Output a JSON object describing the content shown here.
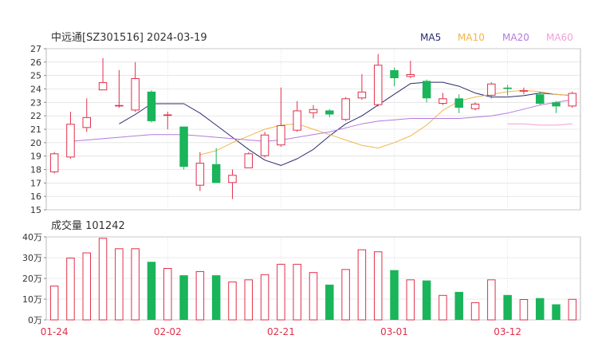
{
  "header": {
    "title": "中远通[SZ301516] 2024-03-19",
    "legend": [
      {
        "name": "MA5",
        "color": "#2a2a6e"
      },
      {
        "name": "MA10",
        "color": "#f2b64a"
      },
      {
        "name": "MA20",
        "color": "#b47adf"
      },
      {
        "name": "MA60",
        "color": "#f2a0d8"
      }
    ]
  },
  "volume_panel": {
    "label": "成交量 101242"
  },
  "colors": {
    "up": "#e0304a",
    "down": "#1ab45a",
    "grid": "#d8d8d8",
    "axis_text": "#333333",
    "date_text": "#e0304a"
  },
  "chart_data": [
    {
      "type": "candlestick",
      "title": "中远通[SZ301516] 2024-03-19",
      "ylim": [
        15,
        27
      ],
      "yticks": [
        15,
        16,
        17,
        18,
        19,
        20,
        21,
        22,
        23,
        24,
        25,
        26,
        27
      ],
      "xticks": [
        {
          "label": "01-24",
          "index": 0
        },
        {
          "label": "02-02",
          "index": 7
        },
        {
          "label": "02-21",
          "index": 14
        },
        {
          "label": "03-01",
          "index": 21
        },
        {
          "label": "03-12",
          "index": 28
        }
      ],
      "grid": true,
      "legend_position": "top-right",
      "candles": [
        {
          "open": 17.8,
          "close": 19.2,
          "high": 19.3,
          "low": 17.7
        },
        {
          "open": 18.9,
          "close": 21.4,
          "high": 22.3,
          "low": 18.8
        },
        {
          "open": 21.1,
          "close": 21.9,
          "high": 23.3,
          "low": 20.8
        },
        {
          "open": 23.9,
          "close": 24.5,
          "high": 26.3,
          "low": 23.9
        },
        {
          "open": 22.7,
          "close": 22.8,
          "high": 25.4,
          "low": 22.6
        },
        {
          "open": 22.4,
          "close": 24.8,
          "high": 26.0,
          "low": 22.3
        },
        {
          "open": 23.8,
          "close": 21.6,
          "high": 23.9,
          "low": 21.5
        },
        {
          "open": 22.0,
          "close": 22.1,
          "high": 22.3,
          "low": 21.0
        },
        {
          "open": 21.2,
          "close": 18.2,
          "high": 21.2,
          "low": 18.0
        },
        {
          "open": 16.8,
          "close": 18.5,
          "high": 19.3,
          "low": 16.4
        },
        {
          "open": 18.4,
          "close": 17.0,
          "high": 19.6,
          "low": 17.0
        },
        {
          "open": 17.0,
          "close": 17.6,
          "high": 18.0,
          "low": 15.8
        },
        {
          "open": 18.1,
          "close": 19.2,
          "high": 19.3,
          "low": 18.1
        },
        {
          "open": 19.0,
          "close": 20.6,
          "high": 20.8,
          "low": 18.9
        },
        {
          "open": 19.8,
          "close": 21.3,
          "high": 24.1,
          "low": 19.7
        },
        {
          "open": 20.9,
          "close": 22.4,
          "high": 23.1,
          "low": 20.8
        },
        {
          "open": 22.2,
          "close": 22.5,
          "high": 22.8,
          "low": 21.8
        },
        {
          "open": 22.4,
          "close": 22.1,
          "high": 22.5,
          "low": 21.9
        },
        {
          "open": 21.7,
          "close": 23.3,
          "high": 23.4,
          "low": 21.6
        },
        {
          "open": 23.3,
          "close": 23.8,
          "high": 25.1,
          "low": 23.2
        },
        {
          "open": 22.8,
          "close": 25.8,
          "high": 26.6,
          "low": 22.7
        },
        {
          "open": 25.4,
          "close": 24.8,
          "high": 25.6,
          "low": 24.2
        },
        {
          "open": 24.9,
          "close": 25.1,
          "high": 26.1,
          "low": 24.8
        },
        {
          "open": 24.6,
          "close": 23.3,
          "high": 24.7,
          "low": 23.0
        },
        {
          "open": 22.9,
          "close": 23.3,
          "high": 23.7,
          "low": 22.8
        },
        {
          "open": 23.3,
          "close": 22.6,
          "high": 23.6,
          "low": 22.2
        },
        {
          "open": 22.5,
          "close": 22.9,
          "high": 23.0,
          "low": 22.4
        },
        {
          "open": 23.5,
          "close": 24.4,
          "high": 24.5,
          "low": 23.3
        },
        {
          "open": 24.1,
          "close": 24.0,
          "high": 24.3,
          "low": 23.5
        },
        {
          "open": 23.8,
          "close": 23.9,
          "high": 24.1,
          "low": 23.6
        },
        {
          "open": 23.6,
          "close": 22.9,
          "high": 23.8,
          "low": 22.8
        },
        {
          "open": 23.0,
          "close": 22.7,
          "high": 23.1,
          "low": 22.2
        },
        {
          "open": 22.7,
          "close": 23.7,
          "high": 23.8,
          "low": 22.6
        }
      ],
      "ma": [
        {
          "name": "MA5",
          "values": [
            null,
            null,
            null,
            null,
            21.4,
            22.1,
            22.9,
            22.9,
            22.9,
            22.2,
            21.3,
            20.4,
            19.5,
            18.7,
            18.3,
            18.8,
            19.5,
            20.5,
            21.4,
            22.0,
            22.8,
            23.6,
            24.4,
            24.5,
            24.5,
            24.2,
            23.7,
            23.4,
            23.4,
            23.5,
            23.7,
            23.6,
            23.5
          ]
        },
        {
          "name": "MA10",
          "values": [
            null,
            null,
            null,
            null,
            null,
            null,
            null,
            null,
            null,
            19.1,
            19.4,
            20.0,
            20.5,
            21.0,
            21.3,
            21.4,
            21.0,
            20.6,
            20.2,
            19.8,
            19.6,
            20.0,
            20.5,
            21.3,
            22.4,
            23.1,
            23.4,
            23.6,
            23.8,
            23.9,
            23.8,
            23.6,
            23.5
          ]
        },
        {
          "name": "MA20",
          "values": [
            null,
            20.1,
            20.2,
            20.3,
            20.4,
            20.5,
            20.6,
            20.6,
            20.6,
            20.5,
            20.4,
            20.3,
            20.2,
            20.1,
            20.2,
            20.4,
            20.6,
            20.8,
            21.1,
            21.4,
            21.6,
            21.7,
            21.8,
            21.8,
            21.8,
            21.8,
            21.9,
            22.0,
            22.2,
            22.5,
            22.8,
            23.0,
            23.2
          ]
        },
        {
          "name": "MA60",
          "values": [
            null,
            null,
            null,
            null,
            null,
            null,
            null,
            null,
            null,
            null,
            null,
            null,
            null,
            null,
            null,
            null,
            null,
            null,
            null,
            null,
            null,
            null,
            null,
            null,
            null,
            null,
            null,
            null,
            21.4,
            21.4,
            21.3,
            21.3,
            21.4
          ]
        }
      ]
    },
    {
      "type": "bar",
      "title": "成交量 101242",
      "ylim": [
        0,
        40
      ],
      "yticks": [
        {
          "value": 0,
          "label": "0万"
        },
        {
          "value": 10,
          "label": "10万"
        },
        {
          "value": 20,
          "label": "20万"
        },
        {
          "value": 30,
          "label": "30万"
        },
        {
          "value": 40,
          "label": "40万"
        }
      ],
      "grid": true,
      "values": [
        16.5,
        30.0,
        32.5,
        39.5,
        34.5,
        34.5,
        28.0,
        25.0,
        21.5,
        23.5,
        21.5,
        18.5,
        19.5,
        22.0,
        27.0,
        27.0,
        23.0,
        17.0,
        24.5,
        34.0,
        33.0,
        24.0,
        19.5,
        19.0,
        12.0,
        13.5,
        8.5,
        19.5,
        12.0,
        10.0,
        10.5,
        7.5,
        10.1
      ]
    }
  ]
}
